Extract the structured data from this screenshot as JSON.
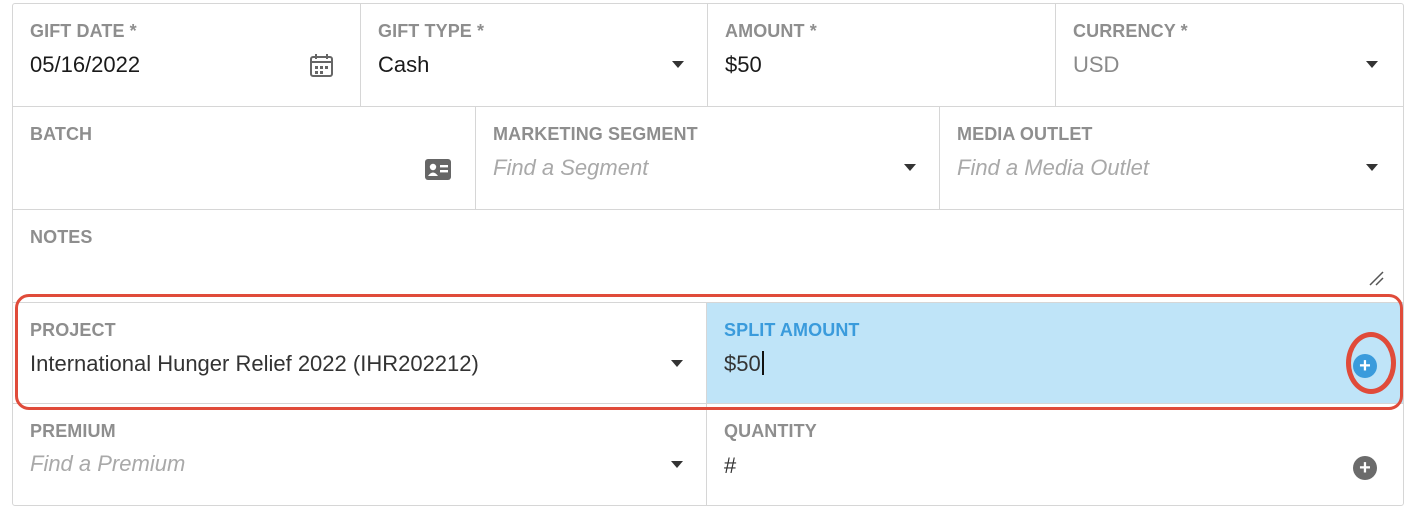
{
  "gift_date": {
    "label": "GIFT DATE *",
    "value": "05/16/2022",
    "icon": "calendar-icon"
  },
  "gift_type": {
    "label": "GIFT TYPE *",
    "value": "Cash"
  },
  "amount": {
    "label": "AMOUNT *",
    "value": "$50"
  },
  "currency": {
    "label": "CURRENCY *",
    "value": "USD"
  },
  "batch": {
    "label": "BATCH",
    "value": "",
    "icon": "id-card-icon"
  },
  "marketing_segment": {
    "label": "MARKETING SEGMENT",
    "placeholder": "Find a Segment"
  },
  "media_outlet": {
    "label": "MEDIA OUTLET",
    "placeholder": "Find a Media Outlet"
  },
  "notes": {
    "label": "NOTES",
    "value": ""
  },
  "project": {
    "label": "PROJECT",
    "value": "International Hunger Relief 2022 (IHR202212)"
  },
  "split_amount": {
    "label": "SPLIT AMOUNT",
    "value": "$50"
  },
  "premium": {
    "label": "PREMIUM",
    "placeholder": "Find a Premium"
  },
  "quantity": {
    "label": "QUANTITY",
    "value": "#"
  },
  "colors": {
    "border": "#d6d6d6",
    "label": "#8e8e8e",
    "split_bg": "#bfe4f8",
    "split_label": "#3a9bdc",
    "highlight": "#e04b3a"
  }
}
